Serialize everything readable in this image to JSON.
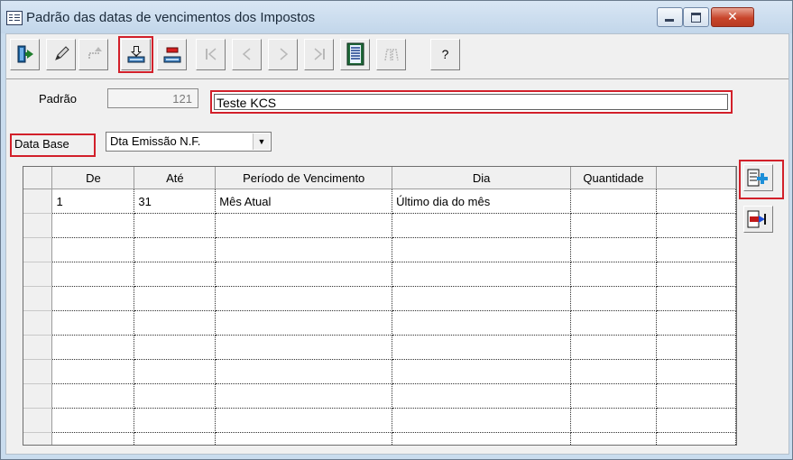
{
  "window": {
    "title": "Padrão das datas de vencimentos dos Impostos",
    "close_glyph": "✕"
  },
  "toolbar": {
    "buttons": [
      {
        "name": "exit-button",
        "icon": "exit-door-icon",
        "glyph": "🚪",
        "enabled": true,
        "highlighted": false
      },
      {
        "name": "edit-button",
        "icon": "pencil-icon",
        "glyph": "✎",
        "enabled": true,
        "highlighted": false
      },
      {
        "name": "undo-button",
        "icon": "undo-icon",
        "glyph": "⟲",
        "enabled": false,
        "highlighted": false
      },
      {
        "name": "save-button",
        "icon": "download-tray-icon",
        "glyph": "⇩",
        "enabled": true,
        "highlighted": true
      },
      {
        "name": "delete-button",
        "icon": "tray-remove-icon",
        "glyph": "▬",
        "enabled": true,
        "highlighted": false
      },
      {
        "name": "first-record-button",
        "icon": "first-icon",
        "glyph": "|◁",
        "enabled": false,
        "highlighted": false
      },
      {
        "name": "previous-record-button",
        "icon": "previous-icon",
        "glyph": "◁",
        "enabled": false,
        "highlighted": false
      },
      {
        "name": "next-record-button",
        "icon": "next-icon",
        "glyph": "▷",
        "enabled": false,
        "highlighted": false
      },
      {
        "name": "last-record-button",
        "icon": "last-icon",
        "glyph": "▷|",
        "enabled": false,
        "highlighted": false
      },
      {
        "name": "list-button",
        "icon": "list-icon",
        "glyph": "▤",
        "enabled": true,
        "highlighted": false
      },
      {
        "name": "search-button",
        "icon": "binoculars-icon",
        "glyph": "⌕",
        "enabled": false,
        "highlighted": false
      },
      {
        "name": "help-button",
        "icon": "help-icon",
        "glyph": "?",
        "enabled": true,
        "highlighted": false
      }
    ]
  },
  "form": {
    "padrao_label": "Padrão",
    "padrao_number": "121",
    "padrao_description": "Teste KCS",
    "data_base_label": "Data Base",
    "data_base_value": "Dta Emissão N.F."
  },
  "grid": {
    "columns": [
      "De",
      "Até",
      "Período de Vencimento",
      "Dia",
      "Quantidade"
    ],
    "rows": [
      [
        "1",
        "31",
        "Mês Atual",
        "Último dia do mês",
        ""
      ],
      [
        "",
        "",
        "",
        "",
        ""
      ],
      [
        "",
        "",
        "",
        "",
        ""
      ],
      [
        "",
        "",
        "",
        "",
        ""
      ],
      [
        "",
        "",
        "",
        "",
        ""
      ],
      [
        "",
        "",
        "",
        "",
        ""
      ],
      [
        "",
        "",
        "",
        "",
        ""
      ],
      [
        "",
        "",
        "",
        "",
        ""
      ],
      [
        "",
        "",
        "",
        "",
        ""
      ],
      [
        "",
        "",
        "",
        "",
        ""
      ],
      [
        "",
        "",
        "",
        "",
        ""
      ]
    ]
  },
  "colors": {
    "highlight": "#d2202a",
    "add_icon": "#1d8fd8",
    "remove_icon": "#c01818"
  }
}
